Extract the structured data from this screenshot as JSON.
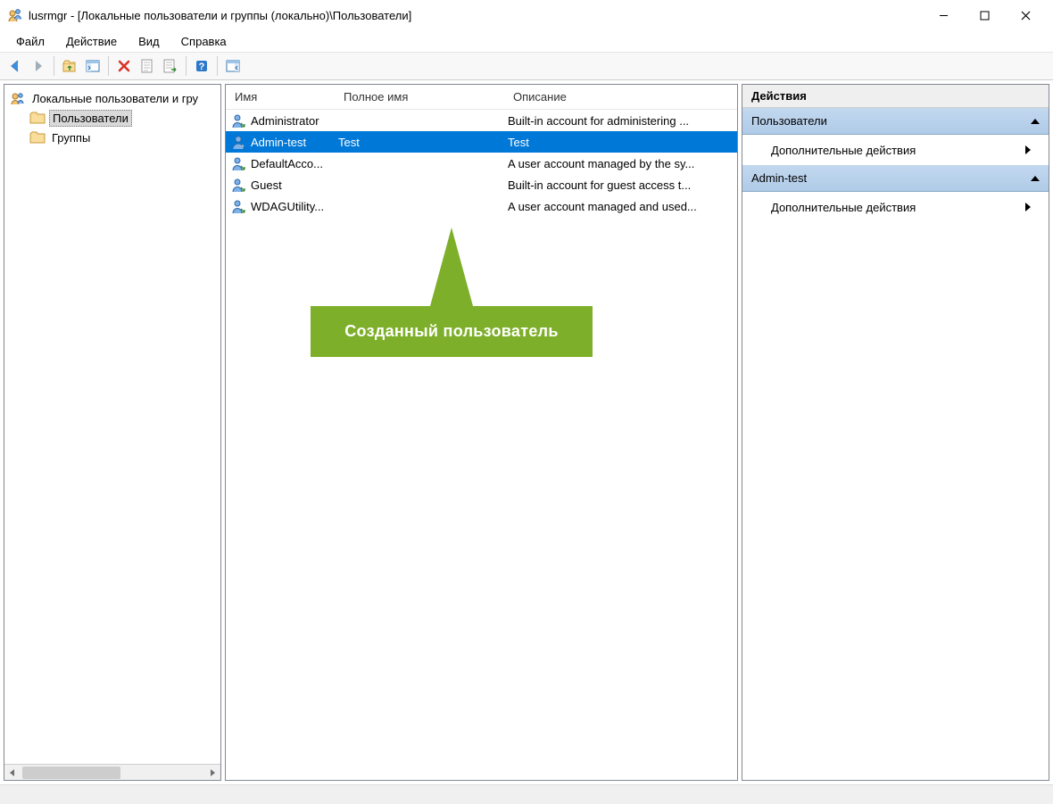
{
  "window": {
    "title": "lusrmgr - [Локальные пользователи и группы (локально)\\Пользователи]"
  },
  "menu": {
    "file": "Файл",
    "action": "Действие",
    "view": "Вид",
    "help": "Справка"
  },
  "tree": {
    "root": "Локальные пользователи и гру",
    "users": "Пользователи",
    "groups": "Группы"
  },
  "columns": {
    "name": "Имя",
    "full": "Полное имя",
    "desc": "Описание"
  },
  "rows": [
    {
      "name": "Administrator",
      "full": "",
      "desc": "Built-in account for administering ...",
      "selected": false
    },
    {
      "name": "Admin-test",
      "full": "Test",
      "desc": "Test",
      "selected": true
    },
    {
      "name": "DefaultAcco...",
      "full": "",
      "desc": "A user account managed by the sy...",
      "selected": false
    },
    {
      "name": "Guest",
      "full": "",
      "desc": "Built-in account for guest access t...",
      "selected": false
    },
    {
      "name": "WDAGUtility...",
      "full": "",
      "desc": "A user account managed and used...",
      "selected": false
    }
  ],
  "actions": {
    "title": "Действия",
    "section1": "Пользователи",
    "item": "Дополнительные действия",
    "section2": "Admin-test"
  },
  "callout": "Созданный пользователь"
}
